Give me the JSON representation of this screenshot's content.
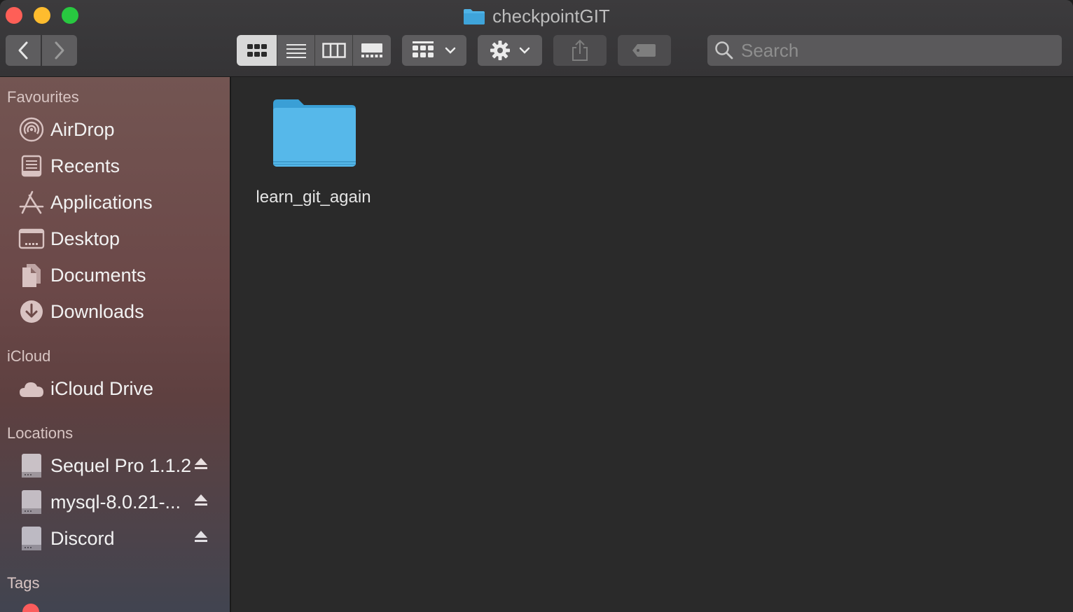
{
  "window": {
    "title": "checkpointGIT"
  },
  "toolbar": {
    "search_placeholder": "Search",
    "view_modes": [
      "icon-view",
      "list-view",
      "column-view",
      "gallery-view"
    ],
    "active_view": "icon-view"
  },
  "sidebar": {
    "favourites_heading": "Favourites",
    "favourites": [
      {
        "label": "AirDrop",
        "icon": "airdrop-icon"
      },
      {
        "label": "Recents",
        "icon": "recents-icon"
      },
      {
        "label": "Applications",
        "icon": "applications-icon"
      },
      {
        "label": "Desktop",
        "icon": "desktop-icon"
      },
      {
        "label": "Documents",
        "icon": "documents-icon"
      },
      {
        "label": "Downloads",
        "icon": "downloads-icon"
      }
    ],
    "icloud_heading": "iCloud",
    "icloud": [
      {
        "label": "iCloud Drive",
        "icon": "cloud-icon"
      }
    ],
    "locations_heading": "Locations",
    "locations": [
      {
        "label": "Sequel Pro 1.1.2",
        "icon": "disk-icon"
      },
      {
        "label": "mysql-8.0.21-...",
        "icon": "disk-icon"
      },
      {
        "label": "Discord",
        "icon": "disk-icon"
      }
    ],
    "tags_heading": "Tags"
  },
  "content": {
    "items": [
      {
        "name": "learn_git_again",
        "kind": "folder"
      }
    ]
  },
  "colors": {
    "folder_blue": "#4fb3e6",
    "close": "#fe5f57",
    "minimize": "#febc2e",
    "maximize": "#28c840"
  }
}
